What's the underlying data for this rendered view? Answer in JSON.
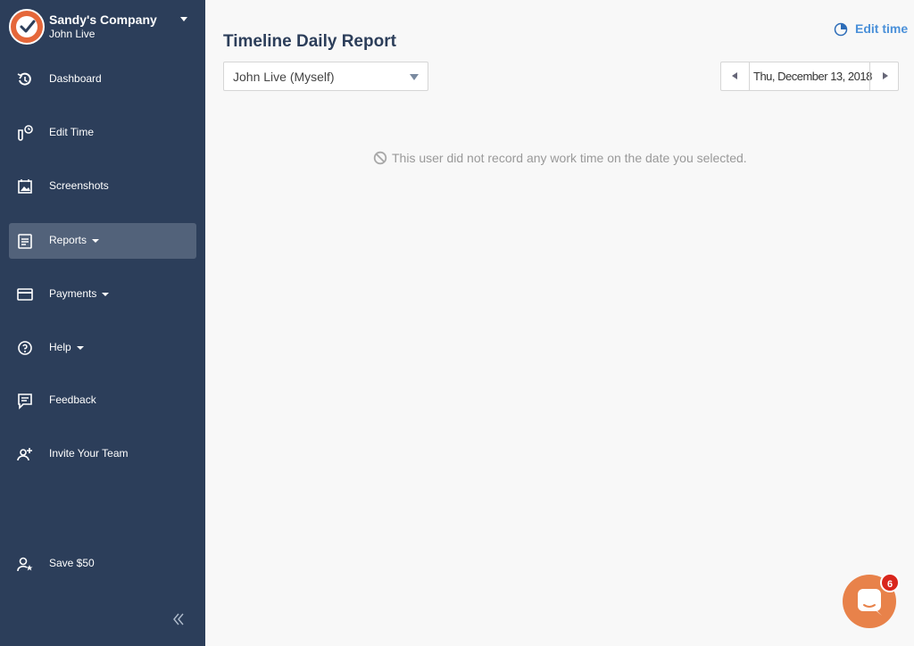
{
  "sidebar": {
    "company": "Sandy's Company",
    "user": "John Live",
    "items": [
      {
        "label": "Dashboard",
        "icon": "history-icon"
      },
      {
        "label": "Edit Time",
        "icon": "edit-time-icon"
      },
      {
        "label": "Screenshots",
        "icon": "screenshots-icon"
      },
      {
        "label": "Reports",
        "icon": "reports-icon"
      },
      {
        "label": "Payments",
        "icon": "credit-card-icon"
      },
      {
        "label": "Help",
        "icon": "help-circle-icon"
      },
      {
        "label": "Feedback",
        "icon": "feedback-icon"
      },
      {
        "label": "Invite Your Team",
        "icon": "add-user-icon"
      },
      {
        "label": "Save $50",
        "icon": "user-star-icon"
      }
    ]
  },
  "header": {
    "title": "Timeline Daily Report",
    "edit_time_label": "Edit time"
  },
  "filters": {
    "user_select": "John Live (Myself)",
    "date": "Thu, December 13, 2018"
  },
  "main": {
    "empty_message": "This user did not record any work time on the date you selected."
  },
  "chat": {
    "badge_count": "6"
  },
  "colors": {
    "sidebar_bg": "#2c3e5a",
    "active_item_bg": "#52627a",
    "accent": "#4a90d9",
    "chat_orange": "#e8824a",
    "badge_red": "#d9261c"
  }
}
